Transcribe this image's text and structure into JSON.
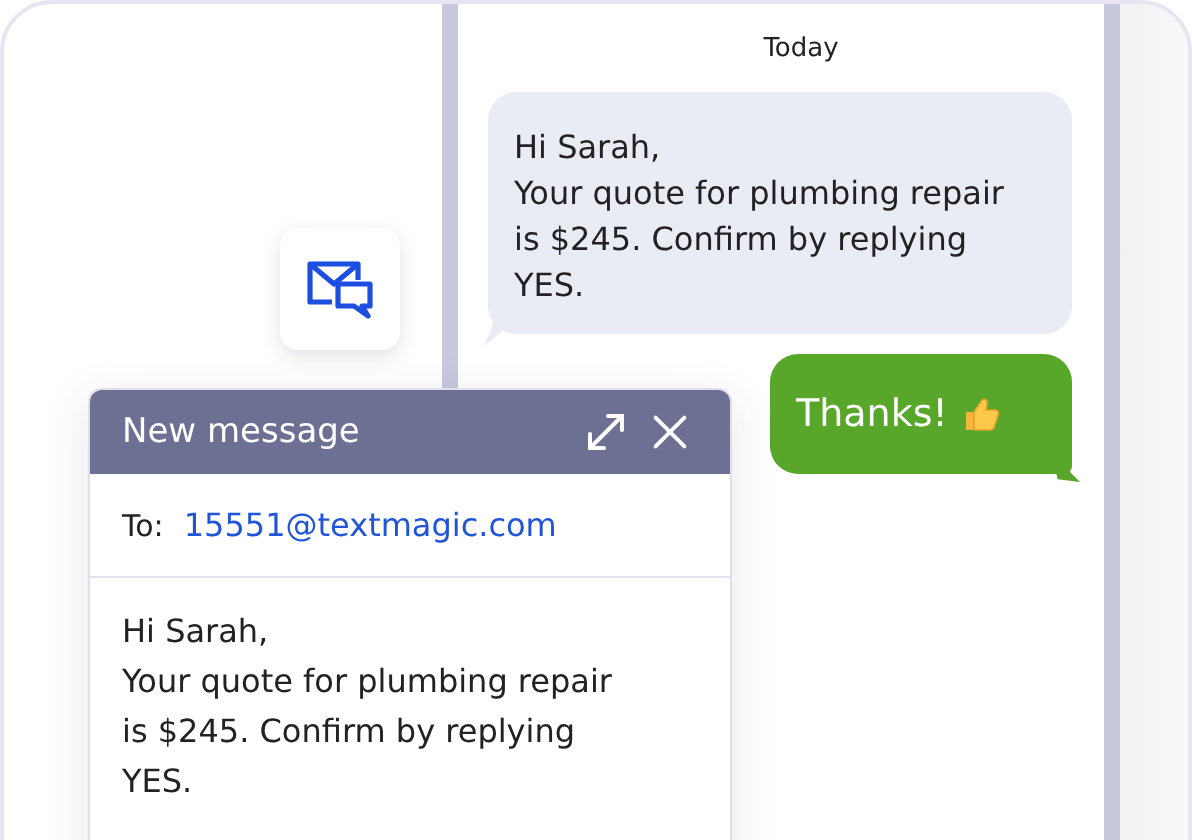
{
  "chat": {
    "date_label": "Today",
    "messages": [
      {
        "kind": "incoming",
        "text": "Hi Sarah,\nYour quote for plumbing repair is $245. Confirm by replying YES.",
        "emoji": false
      },
      {
        "kind": "outgoing",
        "text": "Thanks!",
        "emoji": true
      }
    ]
  },
  "compose": {
    "title": "New message",
    "to_label": "To:",
    "to_value": "15551@textmagic.com",
    "body": "Hi Sarah,\nYour quote for plumbing repair is $245. Confirm by replying YES."
  }
}
